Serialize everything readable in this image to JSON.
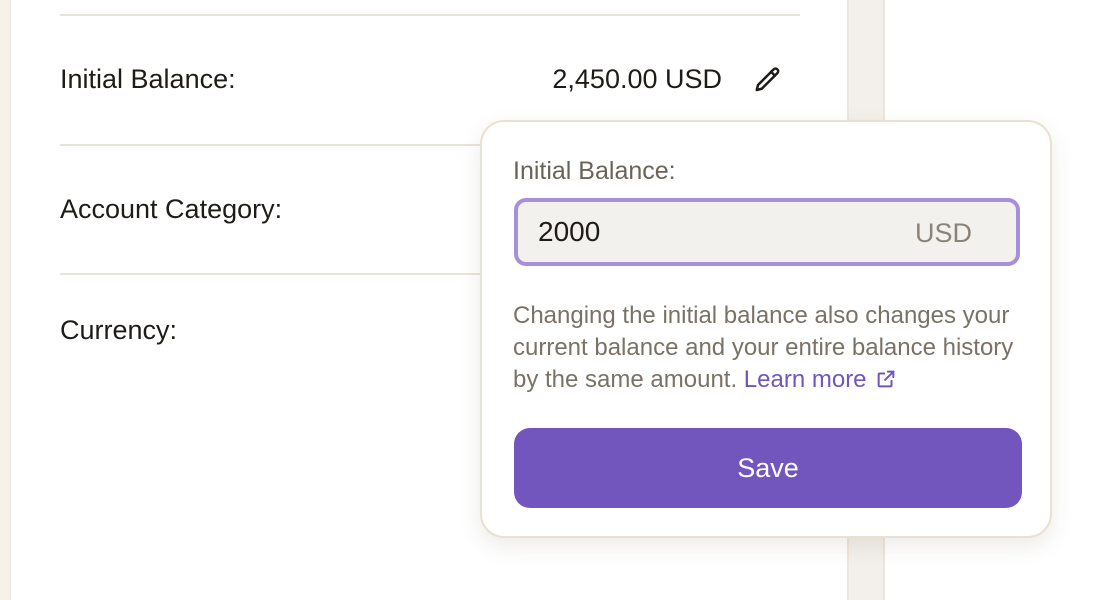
{
  "account_fields": {
    "initial_balance": {
      "label": "Initial Balance:",
      "value": "2,450.00 USD",
      "edit_icon": "pencil-icon"
    },
    "account_category": {
      "label": "Account Category:"
    },
    "currency": {
      "label": "Currency:"
    }
  },
  "popover": {
    "label": "Initial Balance:",
    "input_value": "2000",
    "currency_suffix": "USD",
    "help_text": "Changing the initial balance also changes your current balance and your entire balance history by the same amount.",
    "learn_more_label": "Learn more",
    "learn_more_icon": "external-link-icon",
    "save_label": "Save"
  },
  "colors": {
    "accent": "#7256bd",
    "input_border": "#a690d9",
    "link": "#7056be",
    "divider": "#ece3d6"
  }
}
